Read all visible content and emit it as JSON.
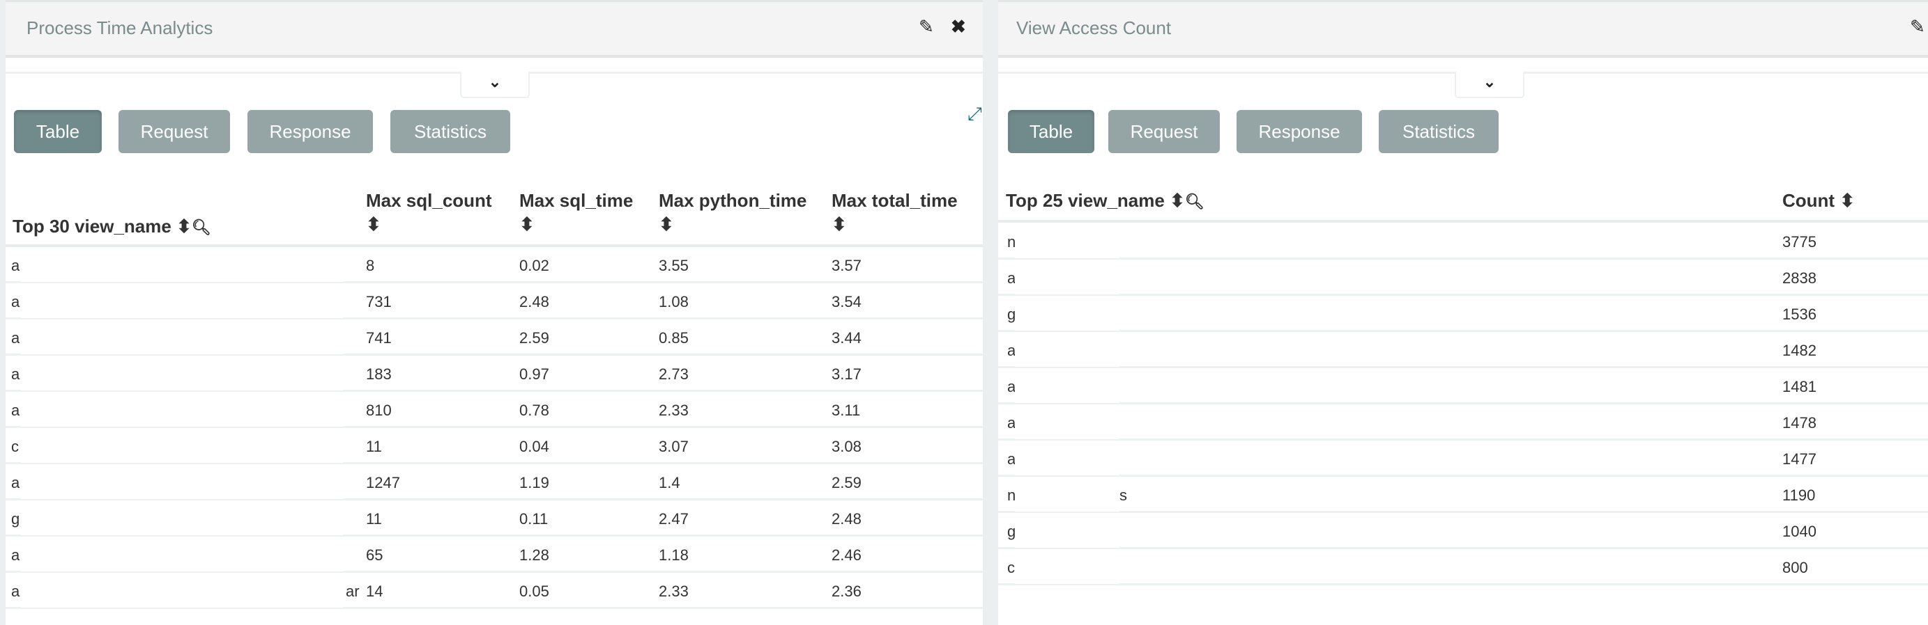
{
  "left": {
    "title": "Process Time Analytics",
    "icons": {
      "edit": "pencil-icon",
      "close": "close-icon",
      "collapse": "chevron-down-icon",
      "expand": "expand-icon"
    },
    "tabs": [
      "Table",
      "Request",
      "Response",
      "Statistics"
    ],
    "active_tab": "Table",
    "headers": {
      "name": "Top 30 view_name",
      "sql_count": "Max sql_count",
      "sql_time": "Max sql_time",
      "python_time": "Max python_time",
      "total_time": "Max total_time"
    },
    "rows": [
      {
        "name": "a",
        "suffix": "",
        "sql_count": "8",
        "sql_time": "0.02",
        "python_time": "3.55",
        "total_time": "3.57"
      },
      {
        "name": "a",
        "suffix": "",
        "sql_count": "731",
        "sql_time": "2.48",
        "python_time": "1.08",
        "total_time": "3.54"
      },
      {
        "name": "a",
        "suffix": "",
        "sql_count": "741",
        "sql_time": "2.59",
        "python_time": "0.85",
        "total_time": "3.44"
      },
      {
        "name": "a",
        "suffix": "",
        "sql_count": "183",
        "sql_time": "0.97",
        "python_time": "2.73",
        "total_time": "3.17"
      },
      {
        "name": "a",
        "suffix": "",
        "sql_count": "810",
        "sql_time": "0.78",
        "python_time": "2.33",
        "total_time": "3.11"
      },
      {
        "name": "c",
        "suffix": "",
        "sql_count": "11",
        "sql_time": "0.04",
        "python_time": "3.07",
        "total_time": "3.08"
      },
      {
        "name": "a",
        "suffix": "",
        "sql_count": "1247",
        "sql_time": "1.19",
        "python_time": "1.4",
        "total_time": "2.59"
      },
      {
        "name": "g",
        "suffix": "",
        "sql_count": "11",
        "sql_time": "0.11",
        "python_time": "2.47",
        "total_time": "2.48"
      },
      {
        "name": "a",
        "suffix": "",
        "sql_count": "65",
        "sql_time": "1.28",
        "python_time": "1.18",
        "total_time": "2.46"
      },
      {
        "name": "a",
        "suffix": "ar",
        "sql_count": "14",
        "sql_time": "0.05",
        "python_time": "2.33",
        "total_time": "2.36"
      }
    ]
  },
  "right": {
    "title": "View Access Count",
    "icons": {
      "edit": "pencil-icon",
      "collapse": "chevron-down-icon"
    },
    "tabs": [
      "Table",
      "Request",
      "Response",
      "Statistics"
    ],
    "active_tab": "Table",
    "headers": {
      "name": "Top 25 view_name",
      "count": "Count"
    },
    "rows": [
      {
        "name": "n",
        "suffix": "",
        "count": "3775"
      },
      {
        "name": "a",
        "suffix": "",
        "count": "2838"
      },
      {
        "name": "g",
        "suffix": "",
        "count": "1536"
      },
      {
        "name": "a",
        "suffix": "",
        "count": "1482"
      },
      {
        "name": "a",
        "suffix": "",
        "count": "1481"
      },
      {
        "name": "a",
        "suffix": "",
        "count": "1478"
      },
      {
        "name": "a",
        "suffix": "",
        "count": "1477"
      },
      {
        "name": "n",
        "suffix": "s",
        "count": "1190"
      },
      {
        "name": "g",
        "suffix": "",
        "count": "1040"
      },
      {
        "name": "c",
        "suffix": "",
        "count": "800"
      }
    ]
  },
  "glyphs": {
    "sort": "⬍",
    "search": "🔍"
  }
}
